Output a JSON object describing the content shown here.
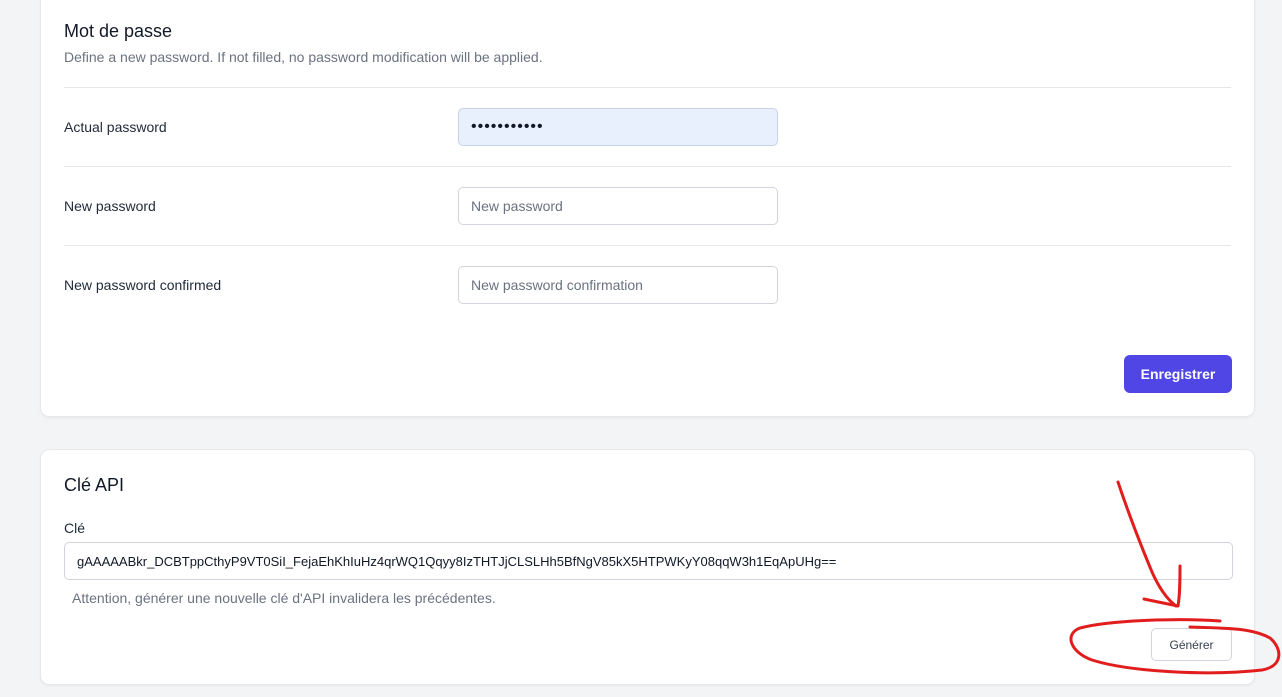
{
  "password_section": {
    "title": "Mot de passe",
    "subtitle": "Define a new password. If not filled, no password modification will be applied.",
    "fields": [
      {
        "label": "Actual password",
        "value": "•••••••••••",
        "placeholder": ""
      },
      {
        "label": "New password",
        "value": "",
        "placeholder": "New password"
      },
      {
        "label": "New password confirmed",
        "value": "",
        "placeholder": "New password confirmation"
      }
    ],
    "save_label": "Enregistrer"
  },
  "api_section": {
    "title": "Clé API",
    "key_label": "Clé",
    "key_value": "gAAAAABkr_DCBTppCthyP9VT0SiI_FejaEhKhIuHz4qrWQ1Qqyy8IzTHTJjCLSLHh5BfNgV85kX5HTPWKyY08qqW3h1EqApUHg==",
    "warning": "Attention, générer une nouvelle clé d'API invalidera les précédentes.",
    "generate_label": "Générer"
  },
  "colors": {
    "accent": "#4f46e5",
    "annotation": "#e11d1d",
    "background": "#f3f4f6"
  }
}
